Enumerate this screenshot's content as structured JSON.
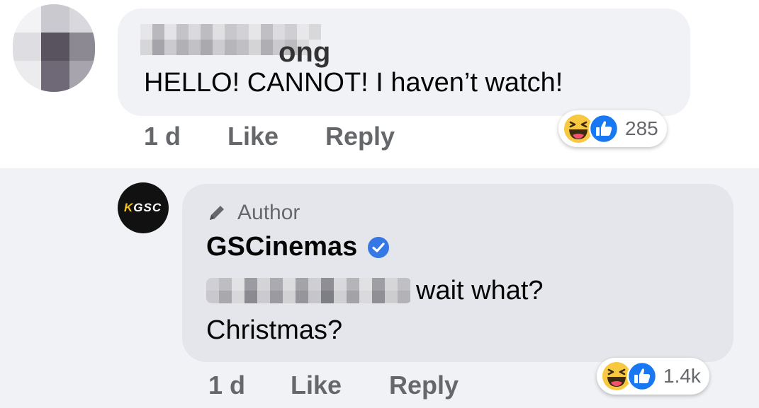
{
  "comment1": {
    "commenter_name": "ong",
    "text": "HELLO! CANNOT! I haven’t watch!",
    "time": "1 d",
    "like_label": "Like",
    "reply_label": "Reply",
    "reactions": {
      "icons": [
        "haha-icon",
        "like-icon"
      ],
      "count": "285"
    }
  },
  "comment2": {
    "author_badge": "Author",
    "name": "GSCinemas",
    "avatar_text": "GSC",
    "text_line1": "wait what?",
    "text_line2": "Christmas?",
    "time": "1 d",
    "like_label": "Like",
    "reply_label": "Reply",
    "reactions": {
      "icons": [
        "haha-icon",
        "like-icon"
      ],
      "count": "1.4k"
    }
  },
  "colors": {
    "like_blue": "#1877f2",
    "haha_yellow": "#f7c840",
    "bubble_gray": "#f0f2f5",
    "meta_gray": "#65676b",
    "verified_blue": "#3578e5"
  }
}
